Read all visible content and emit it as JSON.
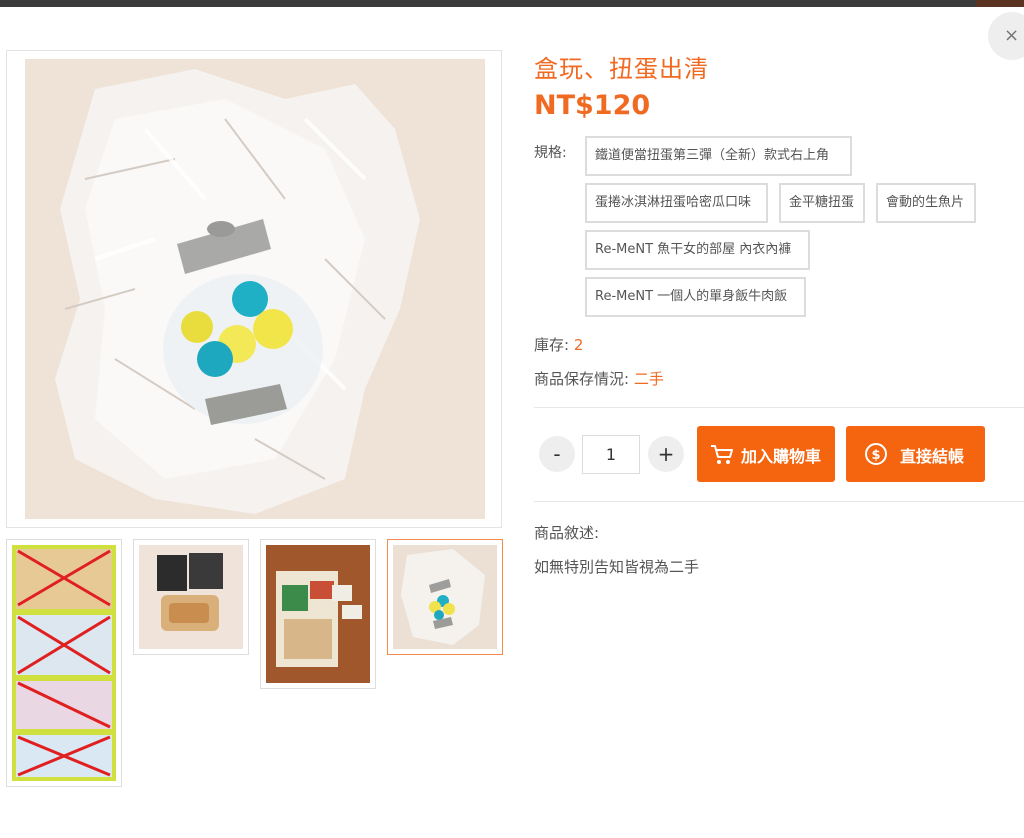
{
  "dialog": {
    "close_label": "×"
  },
  "product": {
    "title": "盒玩、扭蛋出清",
    "price": "NT$120",
    "spec_label": "規格:",
    "spec_options": [
      "鐵道便當扭蛋第三彈（全新）款式右上角",
      "蛋捲冰淇淋扭蛋哈密瓜口味",
      "金平糖扭蛋",
      "會動的生魚片",
      "Re-MeNT 魚干女的部屋 內衣內褲",
      "Re-MeNT 一個人的單身飯牛肉飯"
    ],
    "stock_label": "庫存:",
    "stock_value": "2",
    "condition_label": "商品保存情況:",
    "condition_value": "二手",
    "quantity": "1",
    "minus_label": "-",
    "plus_label": "+",
    "add_to_cart_label": "加入購物車",
    "checkout_label": "直接結帳",
    "description_label": "商品敘述:",
    "description_text": "如無特別告知皆視為二手"
  },
  "gallery": {
    "thumbnails": [
      {
        "name": "thumb-ribbon-figures"
      },
      {
        "name": "thumb-bread-capsule"
      },
      {
        "name": "thumb-station-bento-box"
      },
      {
        "name": "thumb-candy-jar",
        "active": true
      }
    ]
  },
  "colors": {
    "accent": "#f06a22",
    "button": "#f5650f",
    "active_thumb_border": "#f58a4f"
  },
  "icons": {
    "close": "close-icon",
    "cart": "cart-icon",
    "checkout": "dollar-coin-icon"
  }
}
